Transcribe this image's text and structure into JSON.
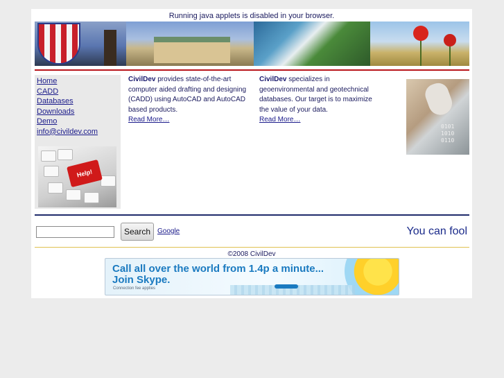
{
  "applet_message": "Running java applets is disabled in your browser.",
  "nav": {
    "items": [
      "Home",
      "CADD",
      "Databases",
      "Downloads",
      "Demo",
      "info@civildev.com"
    ]
  },
  "help_key_label": "Help!",
  "columns": [
    {
      "brand": "CivilDev",
      "text": " provides state-of-the-art computer aided drafting and designing (CADD) using AutoCAD and AutoCAD based products.",
      "link": "Read More…"
    },
    {
      "brand": "CivilDev",
      "text": " specializes in geoenvironmental and geotechnical databases. Our target is to maximize the value of your data.",
      "link": "Read More…"
    }
  ],
  "mouse_binary": "0101\n1010\n0110",
  "search": {
    "placeholder": "",
    "button_label": "Search",
    "engine_link": "Google"
  },
  "ticker_text": "You can fool",
  "copyright": "©2008 CivilDev",
  "ad": {
    "line1": "Call all over the world from 1.4p a minute...",
    "line2": "Join Skype.",
    "small": "Connection fee applies"
  },
  "colors": {
    "brand_navy": "#1a1a5e",
    "rule_red": "#b8141a",
    "rule_navy": "#1f2a6a",
    "skype_blue": "#1a7ac0"
  },
  "icons": [
    "croatian-coat-of-arms",
    "help-keyboard-key",
    "computer-mouse"
  ]
}
